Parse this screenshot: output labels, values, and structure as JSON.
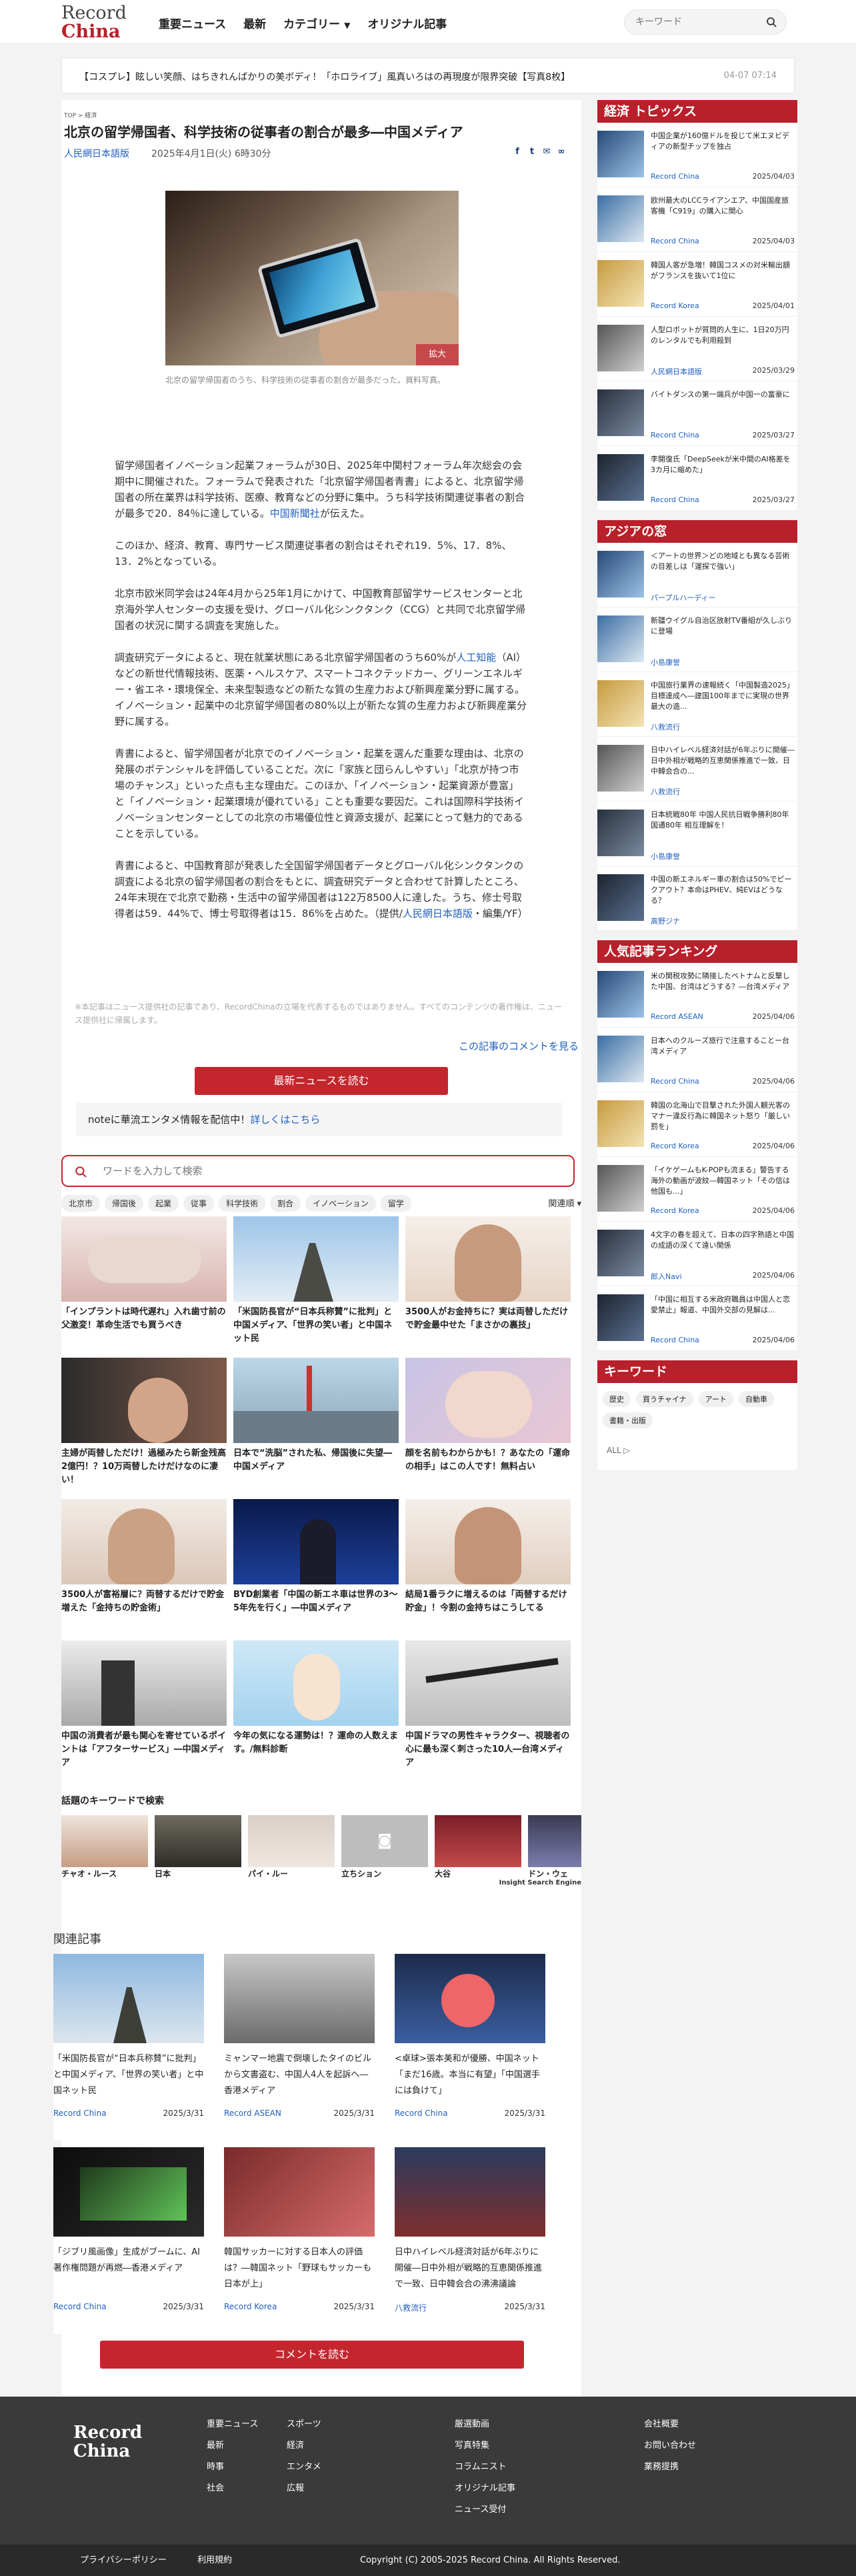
{
  "header": {
    "logo_top": "Record",
    "logo_bottom": "China",
    "nav": [
      "重要ニュース",
      "最新",
      "カテゴリー",
      "オリジナル記事"
    ],
    "search_placeholder": "キーワード"
  },
  "ticker": {
    "text": "【コスプレ】眩しい笑顔、はちきれんばかりの美ボディ！「ホロライブ」風真いろはの再現度が限界突破【写真8枚】",
    "date": "04-07 07:14"
  },
  "article": {
    "breadcrumb": "TOP  >  経済",
    "title": "北京の留学帰国者、科学技術の従事者の割合が最多―中国メディア",
    "source": "人民網日本語版",
    "date": "2025年4月1日(火) 6時30分",
    "zoom_label": "拡大",
    "caption": "北京の留学帰国者のうち、科学技術の従事者の割合が最多だった。資料写真。",
    "p1": "留学帰国者イノベーション起業フォーラムが30日、2025年中関村フォーラム年次総会の会期中に開催された。フォーラムで発表された「北京留学帰国者青書」によると、北京留学帰国者の所在業界は科学技術、医療、教育などの分野に集中。うち科学技術関連従事者の割合が最多で20．84％に達している。",
    "p1_link": "中国新聞社",
    "p1_end": "が伝えた。",
    "p2": "このほか、経済、教育、専門サービス関連従事者の割合はそれぞれ19．5%、17．8%、13．2%となっている。",
    "p3": "北京市欧米同学会は24年4月から25年1月にかけて、中国教育部留学サービスセンターと北京海外学人センターの支援を受け、グローバル化シンクタンク（CCG）と共同で北京留学帰国者の状況に関する調査を実施した。",
    "p4a": "調査研究データによると、現在就業状態にある北京留学帰国者のうち60%が",
    "p4_link": "人工知能",
    "p4b": "（AI）などの新世代情報技術、医薬・ヘルスケア、スマートコネクテッドカー、グリーンエネルギー・省エネ・環境保全、未来型製造などの新たな質の生産力および新興産業分野に属する。イノベーション・起業中の北京留学帰国者の80%以上が新たな質の生産力および新興産業分野に属する。",
    "p5": "青書によると、留学帰国者が北京でのイノベーション・起業を選んだ重要な理由は、北京の発展のポテンシャルを評価していることだ。次に「家族と団らんしやすい」「北京が持つ市場のチャンス」といった点も主な理由だ。このほか、「イノベーション・起業資源が豊富」と「イノベーション・起業環境が優れている」ことも重要な要因だ。これは国際科学技術イノベーションセンターとしての北京の市場優位性と資源支援が、起業にとって魅力的であることを示している。",
    "p6a": "青書によると、中国教育部が発表した全国留学帰国者データとグローバル化シンクタンクの調査による北京の留学帰国者の割合をもとに、調査研究データと合わせて計算したところ、24年末現在で北京で勤務・生活中の留学帰国者は122万8500人に達した。うち、修士号取得者は59．44%で、博士号取得者は15．86%を占めた。（提供/",
    "p6_link": "人民網日本語版",
    "p6b": "・編集/YF）",
    "disclaimer": "※本記事はニュース提供社の記事であり、RecordChinaの立場を代表するものではありません。すべてのコンテンツの著作権は、ニュース提供社に帰属します。",
    "comments_link": "この記事のコメントを見る",
    "read_latest": "最新ニュースを読む",
    "note_text": "noteに華流エンタメ情報を配信中！",
    "note_link": "詳しくはこちら"
  },
  "widget": {
    "search_placeholder": "ワードを入力して検索",
    "tags": [
      "北京市",
      "帰国後",
      "起業",
      "従事",
      "科学技術",
      "割合",
      "イノベーション",
      "留学"
    ],
    "sort": "関連順 ▾",
    "cards": [
      "「インプラントは時代遅れ」入れ歯寸前の父激変！革命生活でも買うべき",
      "「米国防長官が“日本兵称賛”に批判」と中国メディア、「世界の笑い者」と中国ネット民",
      "3500人がお金持ちに？実は両替しただけで貯金最中せた「まさかの裏技」",
      "主婦が両替しただけ！過極みたら新金残高2億円！？10万両替したけだけなのに凄い！",
      "日本で“洗脳”された私、帰国後に失望―中国メディア",
      "顔を名前もわからかも！？あなたの「運命の相手」はこの人です！無料占い",
      "3500人が富裕層に？両替するだけで貯金増えた「金持ちの貯金術」",
      "BYD創業者「中国の新エネ車は世界の3～5年先を行く」―中国メディア",
      "結局1番ラクに増えるのは「両替するだけ貯金」！今割の金持ちはこうしてる",
      "中国の消費者が最も関心を寄せているポイントは「アフターサービス」―中国メディア",
      "今年の気になる運勢は！？運命の人数えます。/無料診断",
      "中国ドラマの男性キャラクター、視聴者の心に最も深く刺さった10人―台湾メディア"
    ],
    "kw_title": "話題のキーワードで検索",
    "keywords": [
      "チャオ・ルース",
      "日本",
      "パイ・ルー",
      "立ちション",
      "大谷",
      "ドン・ウェ"
    ],
    "ise": "Insight Search Engine"
  },
  "related": {
    "title": "関連記事",
    "items": [
      {
        "text": "「米国防長官が“日本兵称賛”に批判」と中国メディア、「世界の笑い者」と中国ネット民",
        "source": "Record China",
        "date": "2025/3/31"
      },
      {
        "text": "ミャンマー地震で倒壊したタイのビルから文書盗む、中国人4人を起訴へ―香港メディア",
        "source": "Record ASEAN",
        "date": "2025/3/31"
      },
      {
        "text": "<卓球>張本美和が優勝、中国ネット「まだ16歳。本当に有望」「中国選手には負けて」",
        "source": "Record China",
        "date": "2025/3/31"
      },
      {
        "text": "「ジブリ風画像」生成がブームに、AI著作権問題が再燃―香港メディア",
        "source": "Record China",
        "date": "2025/3/31"
      },
      {
        "text": "韓国サッカーに対する日本人の評価は？―韓国ネット「野球もサッカーも日本が上」",
        "source": "Record Korea",
        "date": "2025/3/31"
      },
      {
        "text": "日中ハイレベル経済対話が6年ぶりに開催―日中外相が戦略的互恵関係推進で一致、日中韓会合の沸沸議論",
        "source": "八救流行",
        "date": "2025/3/31"
      }
    ],
    "comment_button": "コメントを読む"
  },
  "sidebar": {
    "economy_title": "経済 トピックス",
    "economy": [
      {
        "text": "中国企業が160億ドルを投じて米エヌビディアの新型チップを独占",
        "source": "Record China",
        "date": "2025/04/03"
      },
      {
        "text": "欧州最大のLCCライアンエア、中国国産旅客機「C919」の購入に関心",
        "source": "Record China",
        "date": "2025/04/03"
      },
      {
        "text": "韓国人客が急増！韓国コスメの対米輸出額がフランスを抜いて1位に",
        "source": "Record Korea",
        "date": "2025/04/01"
      },
      {
        "text": "人型ロボットが質問的人生に、1日20万円のレンタルでも利用殺到",
        "source": "人民網日本語版",
        "date": "2025/03/29"
      },
      {
        "text": "バイトダンスの第一端兵が中国一の富豪に",
        "source": "Record China",
        "date": "2025/03/27"
      },
      {
        "text": "李開復氏「DeepSeekが米中間のAI格差を3カ月に縮めた」",
        "source": "Record China",
        "date": "2025/03/27"
      }
    ],
    "asia_title": "アジアの窓",
    "asia": [
      {
        "text": "＜アートの世界＞どの地域とも異なる芸術の目差しは「運探で強い」",
        "source": "パープルハーディー",
        "date": ""
      },
      {
        "text": "新疆ウイグル自治区放射TV番組が久しぶりに登場",
        "source": "小島康誉",
        "date": ""
      },
      {
        "text": "中国旅行業界の速報続く「中国製造2025」目標達成へ―建国100年までに実現の世界最大の造...",
        "source": "八救流行",
        "date": ""
      },
      {
        "text": "日中ハイレベル経済対話が6年ぶりに開催―日中外相が戦略的互恵関係推進で一致、日中韓会合の...",
        "source": "八救流行",
        "date": ""
      },
      {
        "text": "日本統戦80年 中国人民抗日戦争勝利80年 国通80年 相互理解を！",
        "source": "小島康誉",
        "date": ""
      },
      {
        "text": "中国の新エネルギー車の割合は50%でピークアウト？本命はPHEV、純EVはどうなる？",
        "source": "高野ジナ",
        "date": ""
      }
    ],
    "ranking_title": "人気記事ランキング",
    "ranking": [
      {
        "text": "米の関税攻勢に隣接したベトナムと反撃した中国、台湾はどうする？―台湾メディア",
        "source": "Record ASEAN",
        "date": "2025/04/06"
      },
      {
        "text": "日本へのクルーズ旅行で注意することー台湾メディア",
        "source": "Record China",
        "date": "2025/04/06"
      },
      {
        "text": "韓国の北海山で目撃された外国人観光客のマナー違反行為に韓国ネット怒り「厳しい罰を」",
        "source": "Record Korea",
        "date": "2025/04/06"
      },
      {
        "text": "「イケゲームもK-POPも流まる」警告する海外の動画が波紋―韓国ネット「その信は他国も...」",
        "source": "Record Korea",
        "date": "2025/04/06"
      },
      {
        "text": "4文字の春を超えて、日本の四字熟語と中国の成語の深くて遠い関係",
        "source": "郎入Navi",
        "date": "2025/04/06"
      },
      {
        "text": "「中国に相互する米政府職員は中国人と恋愛禁止」報道、中国外交部の見解は...",
        "source": "Record China",
        "date": "2025/04/06"
      }
    ],
    "keyword_title": "キーワード",
    "keywords": [
      "歴史",
      "買うチャイナ",
      "アート",
      "自動車",
      "書籍・出版"
    ],
    "keyword_all": "ALL ▷"
  },
  "footer": {
    "logo_top": "Record",
    "logo_bottom": "China",
    "col1": [
      "重要ニュース",
      "最新",
      "時事",
      "社会"
    ],
    "col2": [
      "スポーツ",
      "経済",
      "エンタメ",
      "広報"
    ],
    "col3": [
      "厳選動画",
      "写真特集",
      "コラムニスト",
      "オリジナル記事",
      "ニュース受付"
    ],
    "col4": [
      "会社概要",
      "お問い合わせ",
      "業務提携"
    ],
    "privacy": "プライバシーポリシー",
    "terms": "利用規約",
    "copyright": "Copyright (C) 2005-2025 Record China. All Rights Reserved."
  }
}
